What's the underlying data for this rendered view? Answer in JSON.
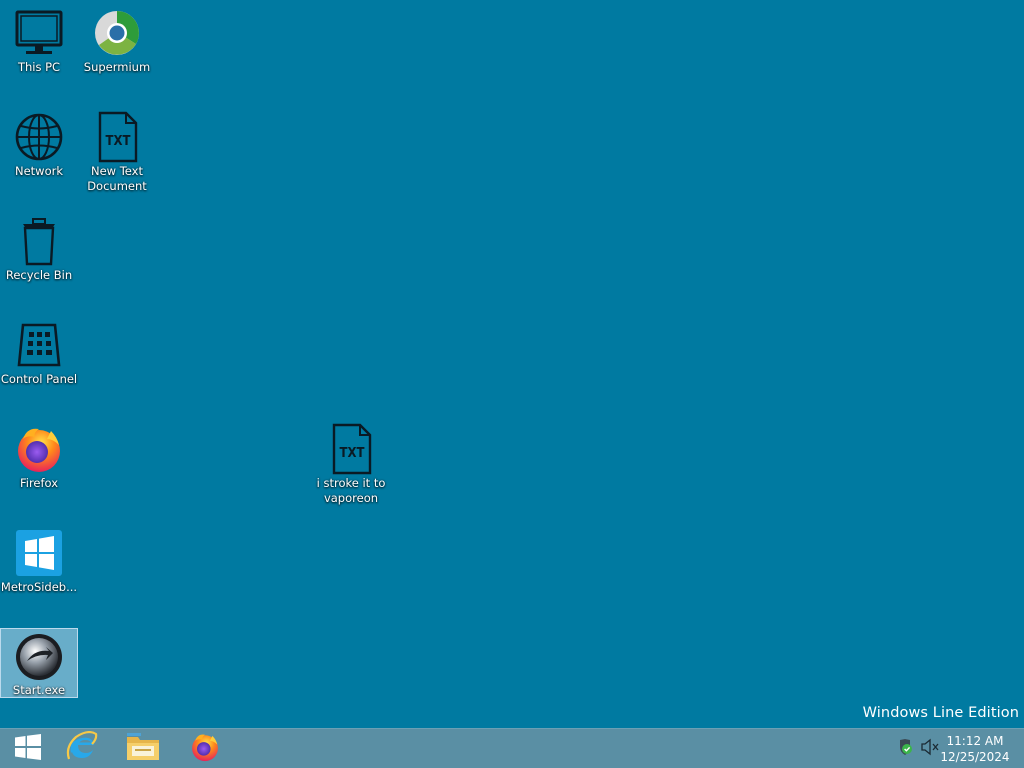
{
  "desktop": {
    "background": "#007aa1",
    "icons": [
      {
        "label": "This PC",
        "icon": "monitor-icon"
      },
      {
        "label": "Supermium",
        "icon": "supermium-browser-icon"
      },
      {
        "label": "Network",
        "icon": "globe-icon"
      },
      {
        "label": "New Text Document",
        "icon": "text-file-icon",
        "file_badge": "TXT"
      },
      {
        "label": "Recycle Bin",
        "icon": "trash-icon"
      },
      {
        "label": "Control Panel",
        "icon": "control-panel-icon"
      },
      {
        "label": "Firefox",
        "icon": "firefox-icon"
      },
      {
        "label": "i stroke it to vaporeon",
        "icon": "text-file-icon",
        "file_badge": "TXT"
      },
      {
        "label": "MetroSideb...",
        "icon": "windows-tile-icon"
      },
      {
        "label": "Start.exe",
        "icon": "start-orb-icon",
        "selected": true
      }
    ],
    "edition_text": "Windows Line Edition"
  },
  "taskbar": {
    "background": "#5a8fa4",
    "pinned": [
      {
        "name": "Start",
        "icon": "windows-logo-icon"
      },
      {
        "name": "Internet Explorer",
        "icon": "internet-explorer-icon"
      },
      {
        "name": "File Explorer",
        "icon": "folder-icon"
      },
      {
        "name": "Firefox",
        "icon": "firefox-icon"
      }
    ],
    "tray": {
      "icons": [
        "security-shield-icon",
        "speaker-muted-icon"
      ],
      "time": "11:12 AM",
      "date": "12/25/2024"
    }
  }
}
